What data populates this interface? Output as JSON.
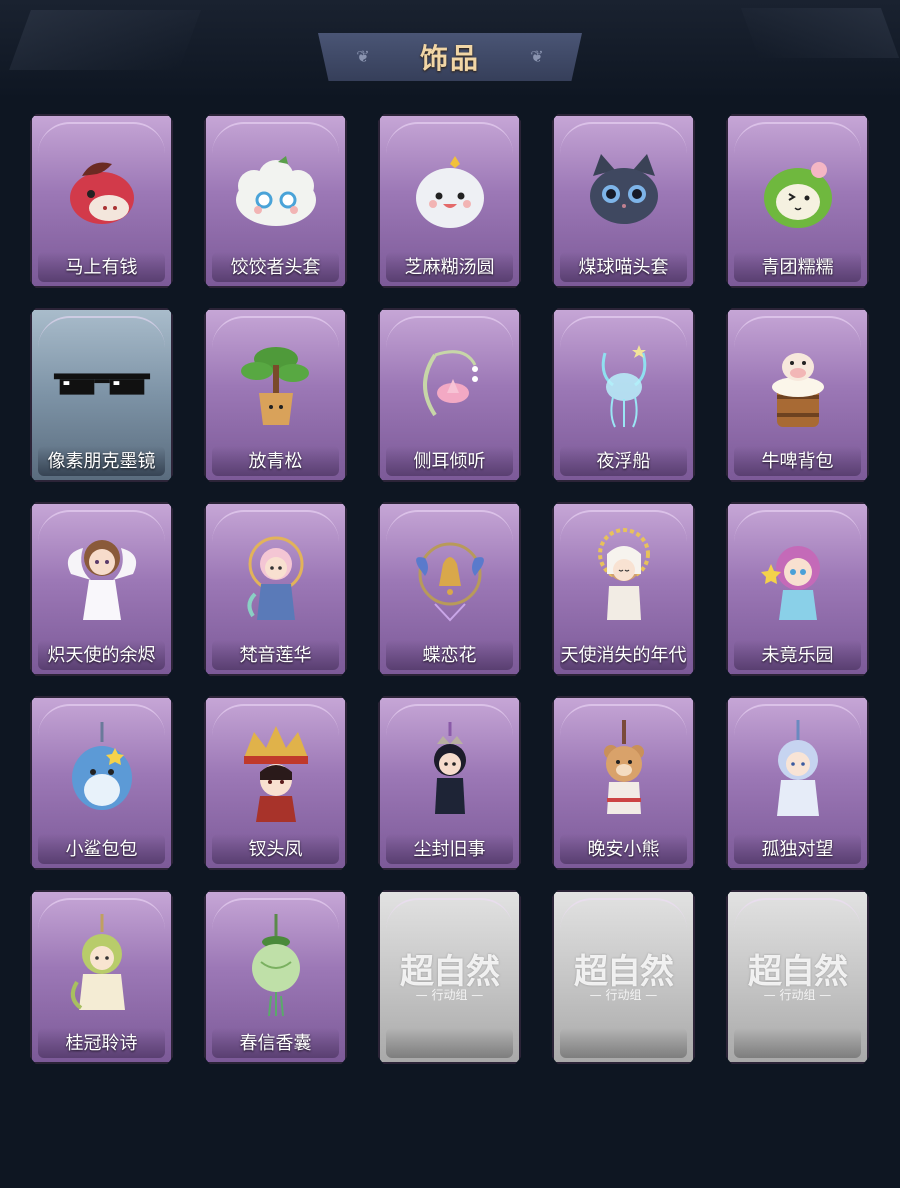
{
  "title": "饰品",
  "items": [
    {
      "name": "马上有钱",
      "icon": "red-horse-head-icon"
    },
    {
      "name": "饺饺者头套",
      "icon": "dumpling-head-icon"
    },
    {
      "name": "芝麻糊汤圆",
      "icon": "rice-ball-icon"
    },
    {
      "name": "煤球喵头套",
      "icon": "black-cat-head-icon"
    },
    {
      "name": "青团糯糯",
      "icon": "green-rice-ball-icon"
    },
    {
      "name": "像素朋克墨镜",
      "icon": "pixel-sunglasses-icon"
    },
    {
      "name": "放青松",
      "icon": "bonsai-pine-icon"
    },
    {
      "name": "侧耳倾听",
      "icon": "lotus-ear-ornament-icon"
    },
    {
      "name": "夜浮船",
      "icon": "jellyfish-icon"
    },
    {
      "name": "牛啤背包",
      "icon": "beer-mug-cow-icon"
    },
    {
      "name": "炽天使的余烬",
      "icon": "angel-doll-icon"
    },
    {
      "name": "梵音莲华",
      "icon": "lotus-doll-icon"
    },
    {
      "name": "蝶恋花",
      "icon": "butterfly-bell-icon"
    },
    {
      "name": "天使消失的年代",
      "icon": "halo-angel-doll-icon"
    },
    {
      "name": "未竟乐园",
      "icon": "starry-doll-icon"
    },
    {
      "name": "小鲨包包",
      "icon": "blue-shark-bag-icon"
    },
    {
      "name": "钗头凤",
      "icon": "phoenix-crown-doll-icon"
    },
    {
      "name": "尘封旧事",
      "icon": "crowned-boy-charm-icon"
    },
    {
      "name": "晚安小熊",
      "icon": "teddy-bear-charm-icon"
    },
    {
      "name": "孤独对望",
      "icon": "blue-haired-doll-charm-icon"
    },
    {
      "name": "桂冠聆诗",
      "icon": "laurel-doll-charm-icon"
    },
    {
      "name": "春信香囊",
      "icon": "sachet-charm-icon"
    },
    {
      "name": "",
      "icon": "placeholder-logo-icon",
      "locked": true
    },
    {
      "name": "",
      "icon": "placeholder-logo-icon",
      "locked": true
    },
    {
      "name": "",
      "icon": "placeholder-logo-icon",
      "locked": true
    }
  ],
  "placeholder": {
    "logo_text": "超自然",
    "logo_sub": "— 行动组 —"
  }
}
